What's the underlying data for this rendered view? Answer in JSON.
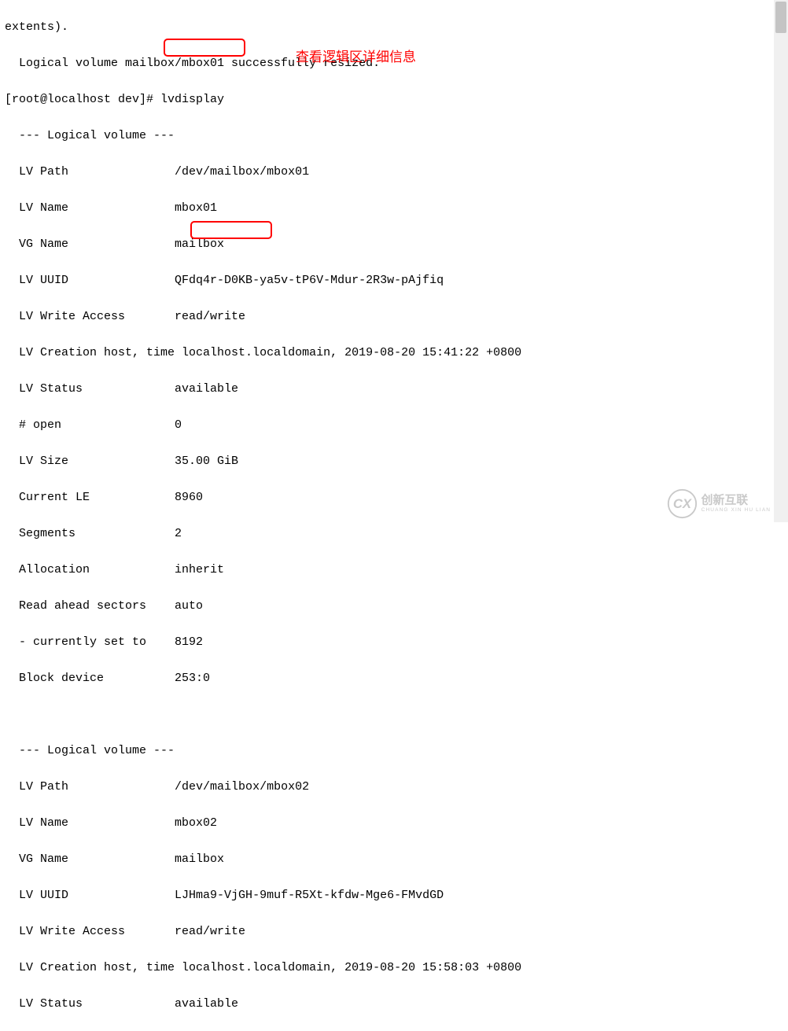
{
  "annotation": "查看逻辑区详细信息",
  "terminal": {
    "l01": "extents).",
    "l02": "  Logical volume mailbox/mbox01 successfully resized.",
    "l03": "[root@localhost dev]# lvdisplay",
    "l04": "  --- Logical volume ---",
    "lv1": {
      "path": {
        "k": "  LV Path               ",
        "v": "/dev/mailbox/mbox01"
      },
      "name": {
        "k": "  LV Name               ",
        "v": "mbox01"
      },
      "vg": {
        "k": "  VG Name               ",
        "v": "mailbox"
      },
      "uuid": {
        "k": "  LV UUID               ",
        "v": "QFdq4r-D0KB-ya5v-tP6V-Mdur-2R3w-pAjfiq"
      },
      "access": {
        "k": "  LV Write Access       ",
        "v": "read/write"
      },
      "creat": {
        "k": "  LV Creation host, time ",
        "v": "localhost.localdomain, 2019-08-20 15:41:22 +0800"
      },
      "status": {
        "k": "  LV Status             ",
        "v": "available"
      },
      "open": {
        "k": "  # open                ",
        "v": "0"
      },
      "size": {
        "k": "  LV Size               ",
        "v": "35.00 GiB"
      },
      "le": {
        "k": "  Current LE            ",
        "v": "8960"
      },
      "seg": {
        "k": "  Segments              ",
        "v": "2"
      },
      "alloc": {
        "k": "  Allocation            ",
        "v": "inherit"
      },
      "ahead": {
        "k": "  Read ahead sectors    ",
        "v": "auto"
      },
      "cur": {
        "k": "  - currently set to    ",
        "v": "8192"
      },
      "bdev": {
        "k": "  Block device          ",
        "v": "253:0"
      }
    },
    "blank": "   ",
    "l24": "  --- Logical volume ---",
    "lv2": {
      "path": {
        "k": "  LV Path               ",
        "v": "/dev/mailbox/mbox02"
      },
      "name": {
        "k": "  LV Name               ",
        "v": "mbox02"
      },
      "vg": {
        "k": "  VG Name               ",
        "v": "mailbox"
      },
      "uuid": {
        "k": "  LV UUID               ",
        "v": "LJHma9-VjGH-9muf-R5Xt-kfdw-Mge6-FMvdGD"
      },
      "access": {
        "k": "  LV Write Access       ",
        "v": "read/write"
      },
      "creat": {
        "k": "  LV Creation host, time ",
        "v": "localhost.localdomain, 2019-08-20 15:58:03 +0800"
      },
      "status": {
        "k": "  LV Status             ",
        "v": "available"
      }
    }
  },
  "watermark": {
    "logo": "CX",
    "cn": "创新互联",
    "py": "CHUANG XIN HU LIAN"
  }
}
